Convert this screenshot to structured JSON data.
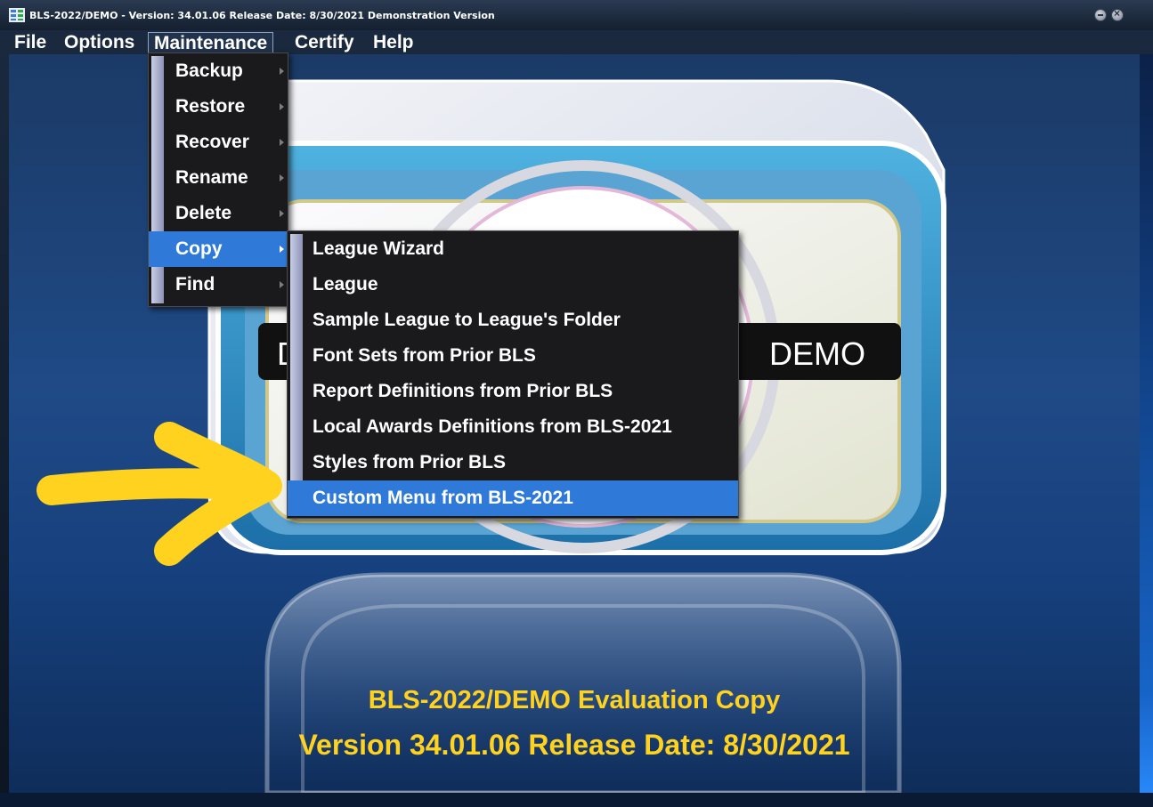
{
  "window": {
    "title": "BLS-2022/DEMO  -  Version: 34.01.06 Release Date: 8/30/2021 Demonstration Version"
  },
  "menubar": [
    {
      "label": "File"
    },
    {
      "label": "Options"
    },
    {
      "label": "Maintenance"
    },
    {
      "label": "Certify"
    },
    {
      "label": "Help"
    }
  ],
  "maintenance_menu": [
    {
      "label": "Backup"
    },
    {
      "label": "Restore"
    },
    {
      "label": "Recover"
    },
    {
      "label": "Rename"
    },
    {
      "label": "Delete"
    },
    {
      "label": "Copy"
    },
    {
      "label": "Find"
    }
  ],
  "copy_submenu": [
    {
      "label": "League Wizard"
    },
    {
      "label": "League"
    },
    {
      "label": "Sample League to League's Folder"
    },
    {
      "label": "Font Sets from Prior BLS"
    },
    {
      "label": "Report Definitions from Prior BLS"
    },
    {
      "label": "Local Awards Definitions from BLS-2021"
    },
    {
      "label": "Styles from Prior BLS"
    },
    {
      "label": "Custom Menu from BLS-2021"
    }
  ],
  "logo": {
    "badge_text": "DEMO",
    "badge_left_fragment": "D"
  },
  "footer": {
    "line1": "BLS-2022/DEMO Evaluation Copy",
    "line2": "Version 34.01.06   Release Date: 8/30/2021"
  },
  "colors": {
    "accent": "#2f7ad8",
    "footer_text": "#ffd21f",
    "annotation_arrow": "#ffd21f"
  }
}
